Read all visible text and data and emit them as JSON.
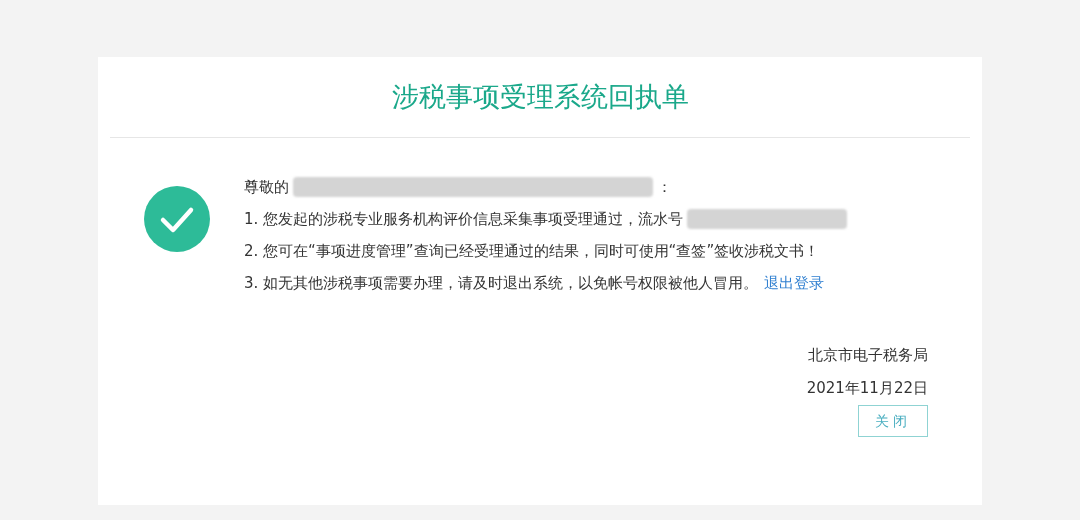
{
  "title": "涉税事项受理系统回执单",
  "greeting": {
    "prefix": "尊敬的",
    "suffix": "："
  },
  "lines": [
    {
      "text": "1. 您发起的涉税专业服务机构评价信息采集事项受理通过，流水号",
      "redacted_tail": true
    },
    {
      "text": "2. 您可在“事项进度管理”查询已经受理通过的结果，同时可使用“查签”签收涉税文书！",
      "redacted_tail": false
    },
    {
      "text": "3. 如无其他涉税事项需要办理，请及时退出系统，以免帐号权限被他人冒用。",
      "redacted_tail": false,
      "link": "退出登录"
    }
  ],
  "signature": {
    "office": "北京市电子税务局",
    "date": "2021年11月22日"
  },
  "close_button": "关闭"
}
